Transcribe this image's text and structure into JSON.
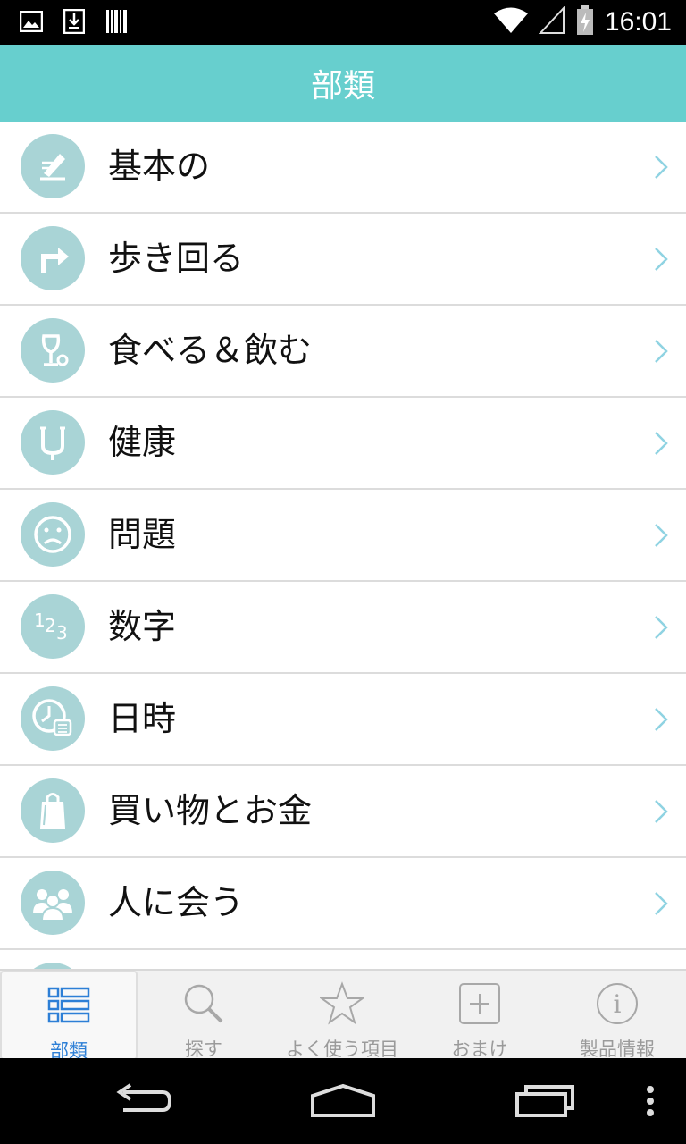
{
  "status_bar": {
    "time": "16:01"
  },
  "header": {
    "title": "部類"
  },
  "categories": [
    {
      "label": "基本の",
      "icon": "pencil-icon"
    },
    {
      "label": "歩き回る",
      "icon": "turn-arrow-icon"
    },
    {
      "label": "食べる＆飲む",
      "icon": "wine-glass-icon"
    },
    {
      "label": "健康",
      "icon": "stethoscope-icon"
    },
    {
      "label": "問題",
      "icon": "sad-face-icon"
    },
    {
      "label": "数字",
      "icon": "numbers-icon"
    },
    {
      "label": "日時",
      "icon": "clock-icon"
    },
    {
      "label": "買い物とお金",
      "icon": "shopping-bag-icon"
    },
    {
      "label": "人に会う",
      "icon": "people-icon"
    }
  ],
  "tabs": [
    {
      "label": "部類",
      "icon": "list-icon",
      "active": true
    },
    {
      "label": "探す",
      "icon": "search-icon"
    },
    {
      "label": "よく使う項目",
      "icon": "star-icon"
    },
    {
      "label": "おまけ",
      "icon": "plus-icon"
    },
    {
      "label": "製品情報",
      "icon": "info-icon"
    }
  ],
  "colors": {
    "header": "#67cfce",
    "icon_circle": "#a9d4d6",
    "chevron": "#8fd3e2",
    "active_tab": "#2d7fd6"
  }
}
